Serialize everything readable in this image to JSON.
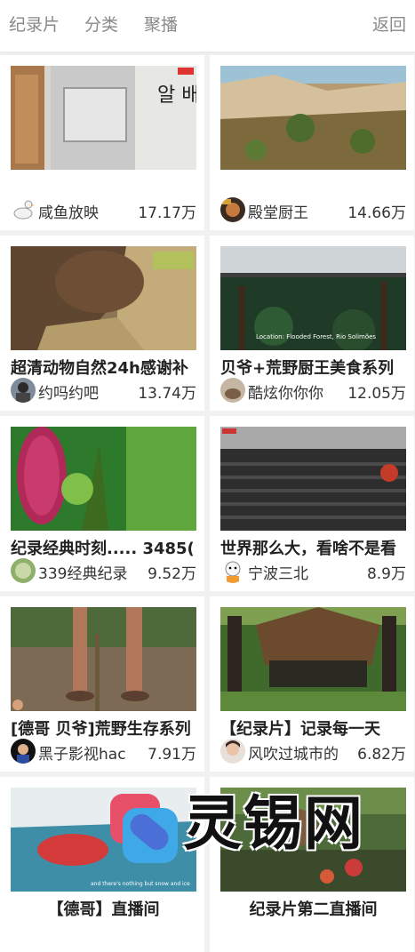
{
  "header": {
    "tabs": [
      {
        "label": "纪录片"
      },
      {
        "label": "分类"
      },
      {
        "label": "聚播"
      }
    ],
    "back_label": "返回"
  },
  "videos": [
    {
      "title": "",
      "uploader": "咸鱼放映",
      "views": "17.17万"
    },
    {
      "title": "",
      "uploader": "殿堂厨王",
      "views": "14.66万"
    },
    {
      "title": "超清动物自然24h感谢补",
      "uploader": "约吗约吧",
      "views": "13.74万"
    },
    {
      "title": "贝爷+荒野厨王美食系列",
      "uploader": "酷炫你你你",
      "views": "12.05万"
    },
    {
      "title": "纪录经典时刻..... 3485(",
      "uploader": "339经典纪录",
      "views": "9.52万"
    },
    {
      "title": "世界那么大，看啥不是看",
      "uploader": "宁波三北",
      "views": "8.9万"
    },
    {
      "title": "[德哥 贝爷]荒野生存系列",
      "uploader": "黑子影视hac",
      "views": "7.91万"
    },
    {
      "title": "【纪录片】记录每一天",
      "uploader": "风吹过城市的",
      "views": "6.82万"
    },
    {
      "title": "【德哥】直播间",
      "uploader": "",
      "views": ""
    },
    {
      "title": "纪录片第二直播间",
      "uploader": "",
      "views": ""
    }
  ],
  "thumb_captions": {
    "v2": "Location: Flooded Forest, Rio Solimões",
    "v8": "and there's nothing but snow and ice"
  },
  "watermark": {
    "text": "灵锡网"
  }
}
